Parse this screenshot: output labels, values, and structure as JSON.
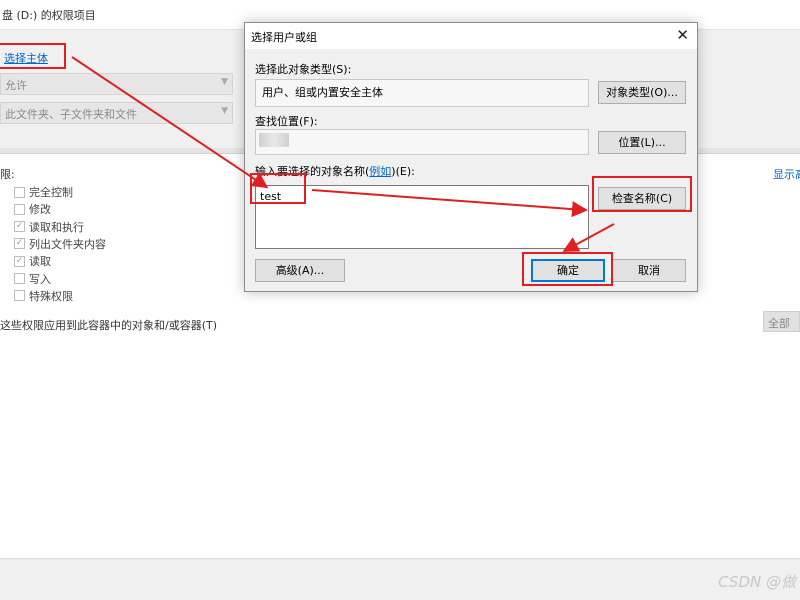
{
  "background": {
    "title": "盘 (D:) 的权限项目",
    "select_principal": "选择主体",
    "type_value": "允许",
    "applies_value": "此文件夹、子文件夹和文件",
    "permissions_label": "限:",
    "permissions": [
      {
        "label": "完全控制",
        "checked": false
      },
      {
        "label": "修改",
        "checked": false
      },
      {
        "label": "读取和执行",
        "checked": true
      },
      {
        "label": "列出文件夹内容",
        "checked": true
      },
      {
        "label": "读取",
        "checked": true
      },
      {
        "label": "写入",
        "checked": false
      },
      {
        "label": "特殊权限",
        "checked": false
      }
    ],
    "apply_option": "这些权限应用到此容器中的对象和/或容器(T)",
    "right_link": "显示高",
    "right_button": "全部",
    "watermark": "CSDN @做"
  },
  "dialog": {
    "title": "选择用户或组",
    "close_glyph": "✕",
    "object_type_label": "选择此对象类型(S):",
    "object_type_value": "用户、组或内置安全主体",
    "object_types_button": "对象类型(O)...",
    "location_label": "查找位置(F):",
    "location_button": "位置(L)...",
    "enter_names_label": "输入要选择的对象名称(",
    "examples_link": "例如",
    "enter_names_label_suffix": ")(E):",
    "names_value": "test",
    "check_names_button": "检查名称(C)",
    "advanced_button": "高级(A)...",
    "ok_button": "确定",
    "cancel_button": "取消"
  },
  "colors": {
    "annotation_red": "#e02020",
    "link_blue": "#0066cc",
    "default_button_border": "#0078d7"
  }
}
